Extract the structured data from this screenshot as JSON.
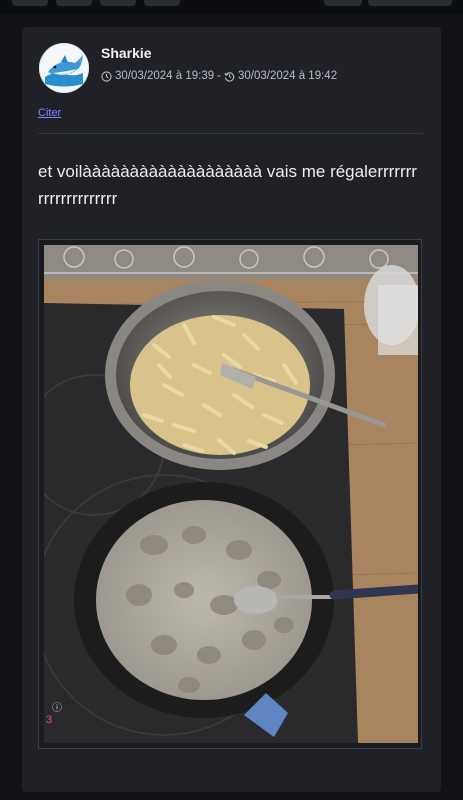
{
  "post": {
    "author": "Sharkie",
    "created": "30/03/2024 à 19:39",
    "separator": "-",
    "edited": "30/03/2024 à 19:42",
    "quote_label": "Citer",
    "body": "et voilààààààààààààààààààà vais me régalerrrrrrrrrrrrrrrrrrrrr"
  },
  "icons": {
    "created": "clock-icon",
    "edited": "history-icon",
    "avatar": "shark-avatar"
  },
  "colors": {
    "background": "#111318",
    "card": "#1f2127",
    "link": "#7a87ff"
  }
}
